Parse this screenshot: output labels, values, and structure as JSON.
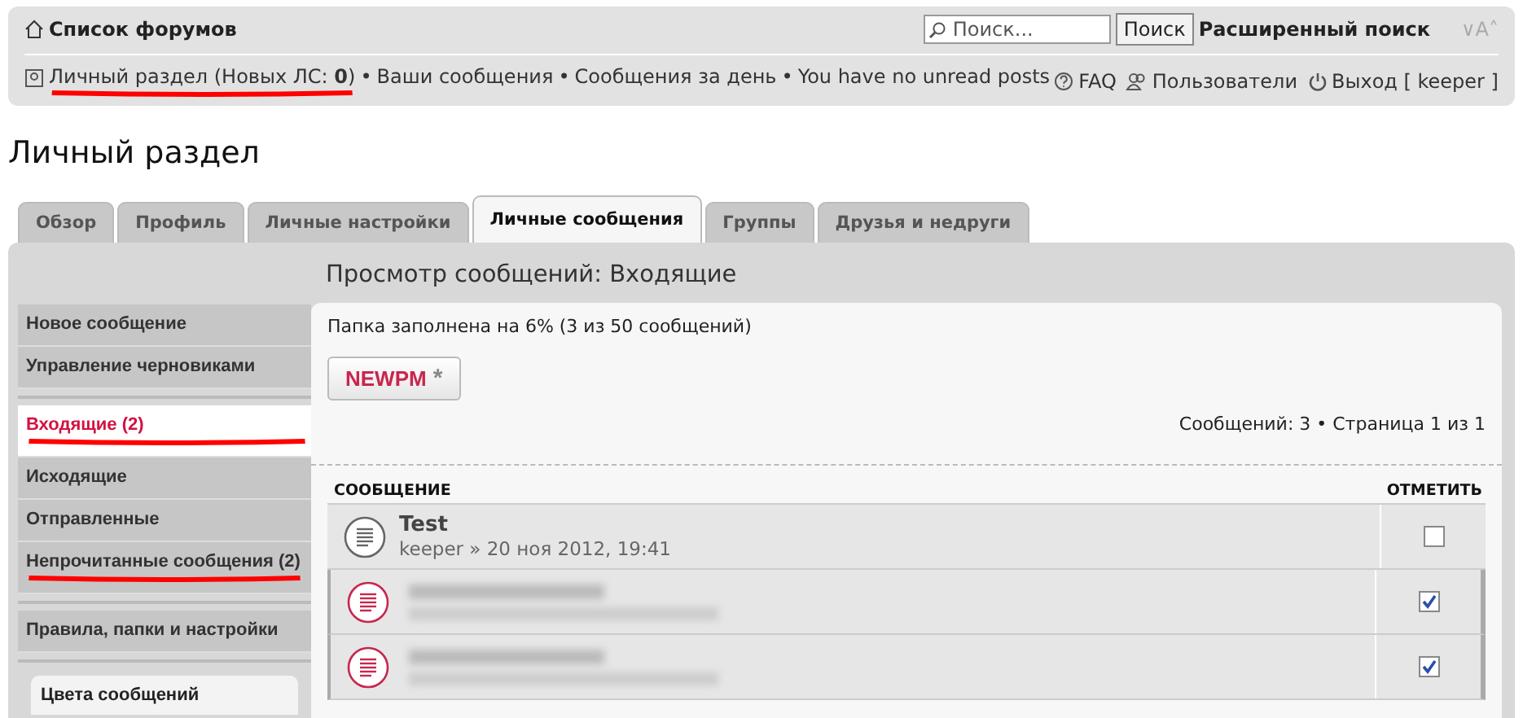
{
  "header": {
    "forum_index": "Список форумов",
    "search": {
      "placeholder": "Поиск..."
    },
    "search_button": "Поиск",
    "advanced_search": "Расширенный поиск",
    "font_size": "∨A˄",
    "user_links": [
      {
        "text": "Личный раздел (Новых ЛС: **0**)",
        "marked": true
      },
      {
        "separator": "•",
        "text": "Ваши сообщения",
        "marked": false
      },
      {
        "separator": "•",
        "text": "Сообщения за день",
        "marked": false
      },
      {
        "separator": "•",
        "text": "You have no unread posts",
        "marked": false
      }
    ],
    "right_links": [
      {
        "kind": "faq",
        "text": "FAQ"
      },
      {
        "kind": "users",
        "text": "Пользователи"
      },
      {
        "kind": "logout",
        "text": "Выход [ keeper ]"
      }
    ]
  },
  "page_title": "Личный раздел",
  "tabs": [
    {
      "label": "Обзор",
      "selected": false
    },
    {
      "label": "Профиль",
      "selected": false
    },
    {
      "label": "Личные настройки",
      "selected": false
    },
    {
      "label": "Личные сообщения",
      "selected": true
    },
    {
      "label": "Группы",
      "selected": false
    },
    {
      "label": "Друзья и недруги",
      "selected": false
    }
  ],
  "sidebar": {
    "groups": [
      [
        {
          "label": "Новое сообщение",
          "selected": false,
          "marked": false
        },
        {
          "label": "Управление черновиками",
          "selected": false,
          "marked": false
        }
      ],
      [
        {
          "label": "Входящие (2)",
          "selected": true,
          "marked": true
        },
        {
          "label": "Исходящие",
          "selected": false,
          "marked": false
        },
        {
          "label": "Отправленные",
          "selected": false,
          "marked": false
        },
        {
          "label": "Непрочитанные сообщения (2)",
          "selected": false,
          "marked": true
        }
      ],
      [
        {
          "label": "Правила, папки и настройки",
          "selected": false,
          "marked": false
        }
      ]
    ],
    "colors_box": "Цвета сообщений"
  },
  "content": {
    "heading": "Просмотр сообщений: Входящие",
    "folder_status": "Папка заполнена на 6% (3 из 50 сообщений)",
    "newpm_button": "NEWPM",
    "newpm_icon": "*",
    "pagination": "Сообщений: 3 • Страница 1 из 1",
    "columns": [
      "СООБЩЕНИЕ",
      "ОТМЕТИТЬ"
    ],
    "messages": [
      {
        "kind": "normal",
        "title": "Test",
        "meta": "keeper » 20 ноя 2012, 19:41",
        "checked": false,
        "unread": false
      },
      {
        "kind": "blurred",
        "checked": true,
        "unread": true
      },
      {
        "kind": "blurred",
        "checked": true,
        "unread": true
      }
    ]
  }
}
